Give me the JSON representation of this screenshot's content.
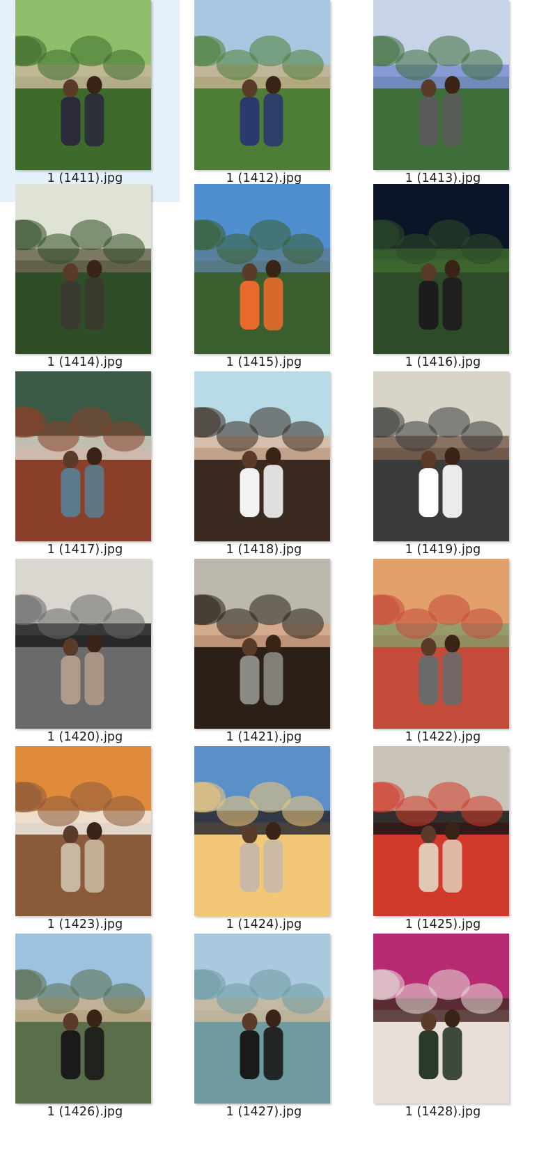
{
  "selection_color": "#e5f1fb",
  "thumbnails": [
    {
      "filename": "1 (1411).jpg",
      "selected": true,
      "scene": "garden-columns",
      "palette": [
        "#8fbf6a",
        "#3e6b2b",
        "#c7b79a",
        "#2a2a3a"
      ]
    },
    {
      "filename": "1 (1412).jpg",
      "selected": false,
      "scene": "garden-columns",
      "palette": [
        "#a9c7e0",
        "#4e7d35",
        "#c4b08e",
        "#2b3a6e"
      ]
    },
    {
      "filename": "1 (1413).jpg",
      "selected": false,
      "scene": "hydrangea",
      "palette": [
        "#c7d3e6",
        "#3e6e3a",
        "#7b8fd1",
        "#5a5a5a"
      ]
    },
    {
      "filename": "1 (1414).jpg",
      "selected": false,
      "scene": "forest-pool",
      "palette": [
        "#dfe3d6",
        "#2f4d26",
        "#6a6650",
        "#3b3a30"
      ]
    },
    {
      "filename": "1 (1415).jpg",
      "selected": false,
      "scene": "beach",
      "palette": [
        "#4f8fd0",
        "#3a5e2e",
        "#5c7e96",
        "#e86a2c"
      ]
    },
    {
      "filename": "1 (1416).jpg",
      "selected": false,
      "scene": "night-garden",
      "palette": [
        "#0c1428",
        "#2e4a28",
        "#3f6a2f",
        "#1c1c1c"
      ]
    },
    {
      "filename": "1 (1417).jpg",
      "selected": false,
      "scene": "restaurant",
      "palette": [
        "#3a5a46",
        "#8a3f2a",
        "#d8d0c4",
        "#5c7a8c"
      ]
    },
    {
      "filename": "1 (1418).jpg",
      "selected": false,
      "scene": "selfie-sky",
      "palette": [
        "#b9dbe8",
        "#3a2a20",
        "#d9b8a0",
        "#f3f3f3"
      ]
    },
    {
      "filename": "1 (1419).jpg",
      "selected": false,
      "scene": "cafe",
      "palette": [
        "#d8d4c8",
        "#3a3a3a",
        "#7a6050",
        "#ffffff"
      ]
    },
    {
      "filename": "1 (1420).jpg",
      "selected": false,
      "scene": "mirror-selfie",
      "palette": [
        "#d9d7d0",
        "#6a6a6a",
        "#1c1c1c",
        "#b09a8a"
      ]
    },
    {
      "filename": "1 (1421).jpg",
      "selected": false,
      "scene": "stairs-selfie",
      "palette": [
        "#bdb8ae",
        "#2a2018",
        "#d9a888",
        "#8c8a84"
      ]
    },
    {
      "filename": "1 (1422).jpg",
      "selected": false,
      "scene": "street",
      "palette": [
        "#e2a06a",
        "#c44a3a",
        "#8a9a6a",
        "#6a6a6a"
      ]
    },
    {
      "filename": "1 (1423).jpg",
      "selected": false,
      "scene": "orange-wall",
      "palette": [
        "#e08a3c",
        "#8a5a3a",
        "#f0ece4",
        "#c8b8a0"
      ]
    },
    {
      "filename": "1 (1424).jpg",
      "selected": false,
      "scene": "sunset-sea",
      "palette": [
        "#5a8fc8",
        "#f2c878",
        "#2a2a30",
        "#c9b8a6"
      ]
    },
    {
      "filename": "1 (1425).jpg",
      "selected": false,
      "scene": "stone-wall",
      "palette": [
        "#c9c3b8",
        "#d13a2a",
        "#151515",
        "#e0c8b4"
      ]
    },
    {
      "filename": "1 (1426).jpg",
      "selected": false,
      "scene": "cliff-view",
      "palette": [
        "#9cc2e0",
        "#5a6e4a",
        "#c8b08e",
        "#1a1a1a"
      ]
    },
    {
      "filename": "1 (1427).jpg",
      "selected": false,
      "scene": "shallow-sea",
      "palette": [
        "#aac8de",
        "#6e9aa0",
        "#c9b79a",
        "#1a1a1a"
      ]
    },
    {
      "filename": "1 (1428).jpg",
      "selected": false,
      "scene": "bougainvillea",
      "palette": [
        "#b52a72",
        "#e8e0d8",
        "#4a2a2a",
        "#2a3a2a"
      ]
    }
  ]
}
